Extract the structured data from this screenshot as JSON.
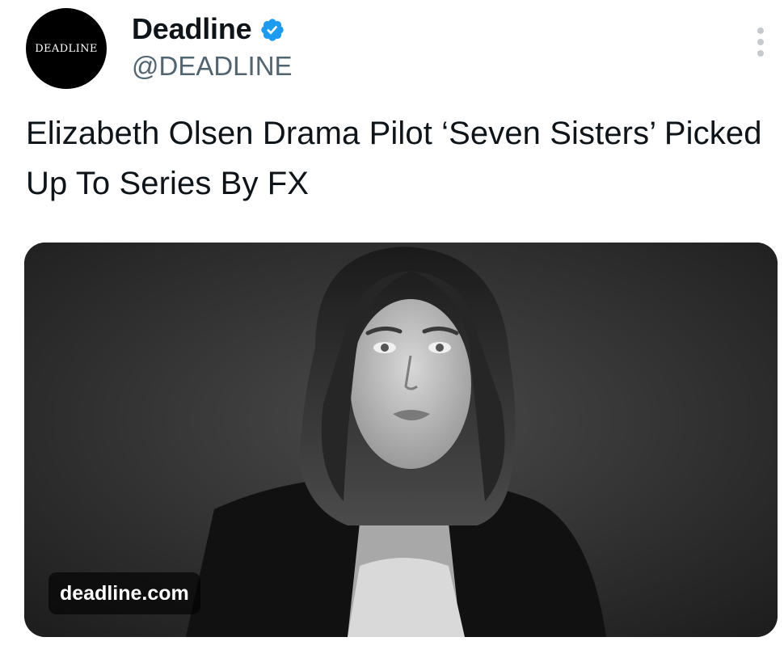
{
  "account": {
    "avatar_text": "DEADLINE",
    "display_name": "Deadline",
    "handle": "@DEADLINE",
    "verified": true,
    "icons": {
      "verified": "verified-badge-icon",
      "more": "more-vertical-icon"
    }
  },
  "tweet": {
    "text": "Elizabeth Olsen Drama Pilot ‘Seven Sisters’ Picked Up To Series By FX"
  },
  "card": {
    "domain": "deadline.com",
    "image": "portrait-photo"
  },
  "colors": {
    "text_primary": "#0f1419",
    "text_secondary": "#536471",
    "verified_blue": "#1d9bf0",
    "avatar_bg": "#000000",
    "more_dots": "#c7c9cc"
  }
}
